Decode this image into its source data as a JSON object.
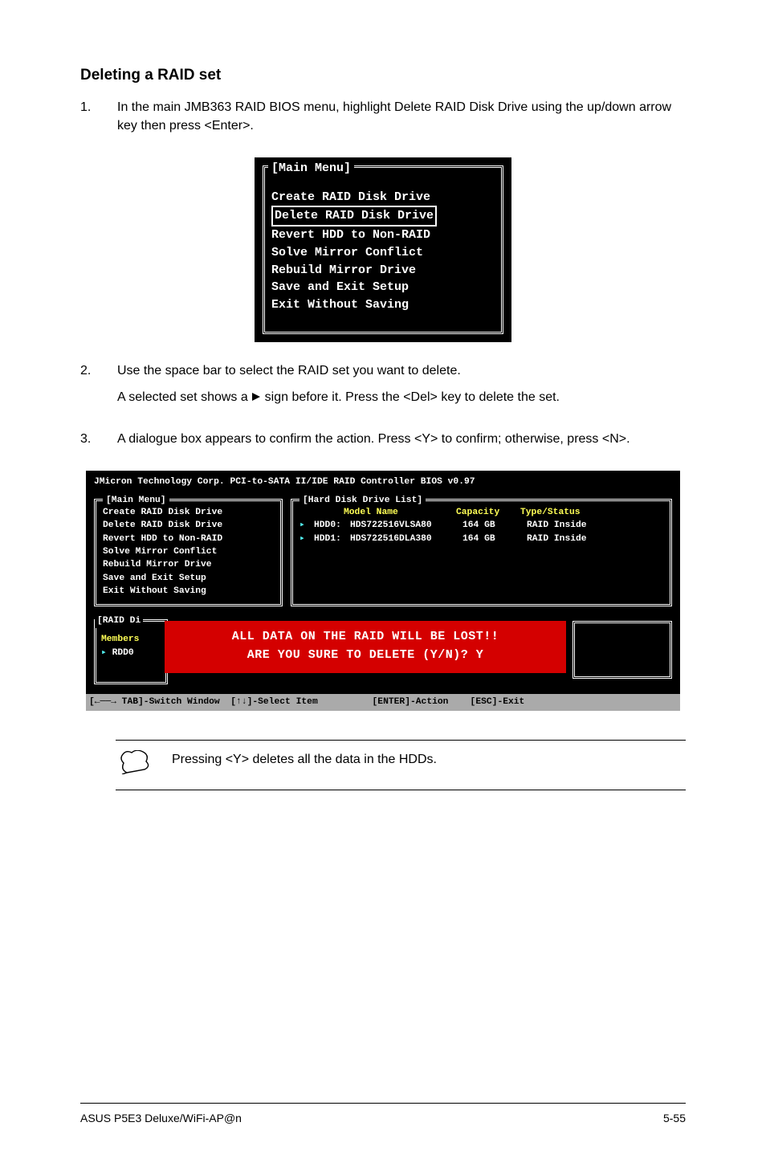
{
  "heading": "Deleting a RAID set",
  "steps": {
    "s1": {
      "num": "1.",
      "text": "In the main JMB363 RAID BIOS menu, highlight Delete RAID Disk Drive using the up/down arrow key then press <Enter>."
    },
    "s2": {
      "num": "2.",
      "text1": "Use the space bar to select the RAID set you want to delete.",
      "text2a": "A selected set shows a ",
      "text2b": " sign before it. Press the <Del> key to delete the set."
    },
    "s3": {
      "num": "3.",
      "text": "A dialogue box appears to confirm the action. Press <Y> to confirm; otherwise, press <N>."
    }
  },
  "bios1": {
    "title": "[Main Menu]",
    "items": [
      "Create RAID Disk Drive",
      "Delete RAID Disk Drive",
      "Revert HDD to Non-RAID",
      "Solve Mirror Conflict",
      "Rebuild Mirror Drive",
      "Save and Exit Setup",
      "Exit Without Saving"
    ],
    "selected_index": 1
  },
  "bios2": {
    "top_title": "JMicron Technology Corp. PCI-to-SATA II/IDE RAID Controller BIOS v0.97",
    "left": {
      "title": "[Main Menu]",
      "items": [
        "Create RAID Disk Drive",
        "Delete RAID Disk Drive",
        "Revert HDD to Non-RAID",
        "Solve Mirror Conflict",
        "Rebuild Mirror Drive",
        "Save and Exit Setup",
        "Exit Without Saving"
      ]
    },
    "right": {
      "title": "[Hard Disk Drive List]",
      "headers": {
        "model": "Model Name",
        "capacity": "Capacity",
        "type": "Type/Status"
      },
      "rows": [
        {
          "dev": "HDD0:",
          "model": "HDS722516VLSA80",
          "cap": "164 GB",
          "type": "RAID Inside"
        },
        {
          "dev": "HDD1:",
          "model": "HDS722516DLA380",
          "cap": "164 GB",
          "type": "RAID Inside"
        }
      ]
    },
    "raid_panel": {
      "title": "[RAID Di",
      "members_label": "Members",
      "item_prefix": "RDD0"
    },
    "dialog": {
      "line1": "ALL DATA ON THE RAID WILL BE LOST!!",
      "line2": "ARE YOU SURE TO DELETE (Y/N)? Y"
    },
    "footer": "[←──→ TAB]-Switch Window  [↑↓]-Select Item          [ENTER]-Action    [ESC]-Exit"
  },
  "note": "Pressing <Y> deletes all the data in the HDDs.",
  "footer": {
    "left": "ASUS P5E3 Deluxe/WiFi-AP@n",
    "right": "5-55"
  }
}
